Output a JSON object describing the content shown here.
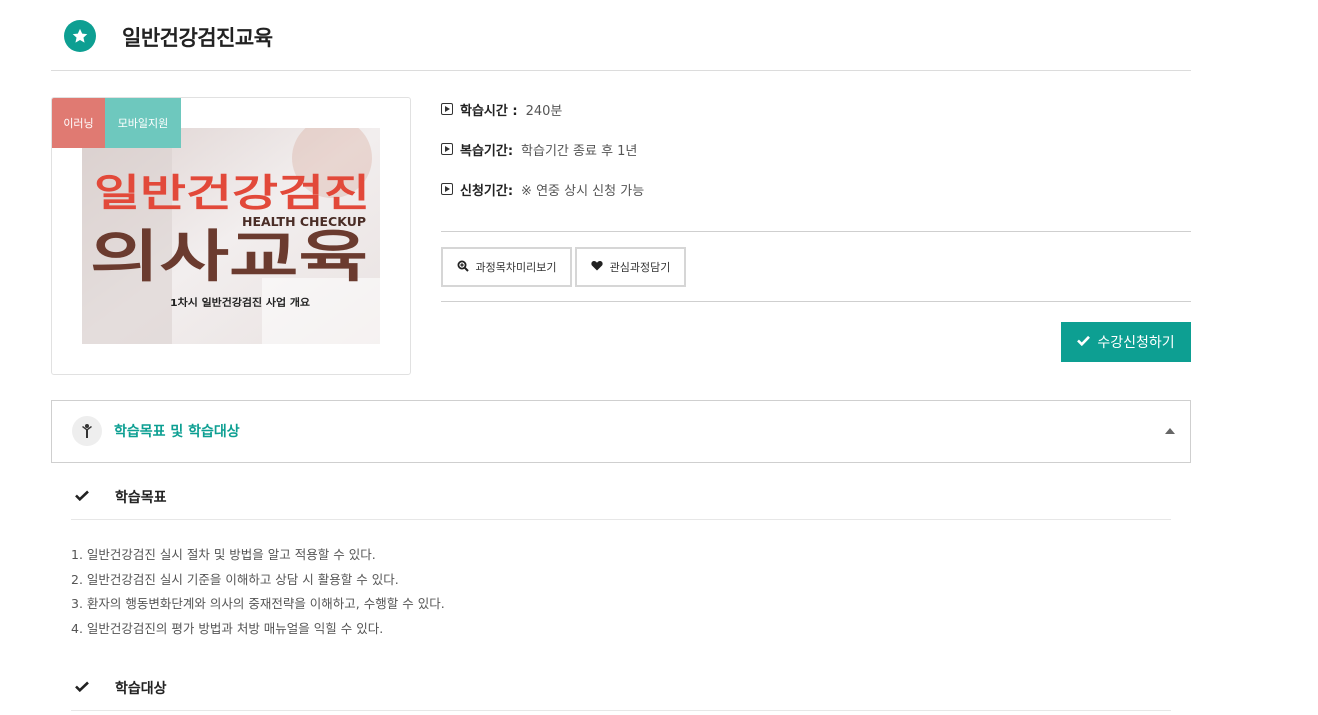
{
  "header": {
    "title": "일반건강검진교육",
    "icon": "star-icon"
  },
  "thumbnail": {
    "tags": [
      "이러닝",
      "모바일지원"
    ],
    "image_text": {
      "line1": "일반건강검진",
      "line2": "HEALTH CHECKUP",
      "line3": "의사교육",
      "caption": "1차시 일반건강검진 사업 개요"
    }
  },
  "info": {
    "study_time": {
      "label": "학습시간 :",
      "value": "240분"
    },
    "review_period": {
      "label": "복습기간:",
      "value": "학습기간 종료 후 1년"
    },
    "apply_period": {
      "label": "신청기간:",
      "value": "※ 연중 상시 신청 가능"
    }
  },
  "actions": {
    "preview_label": "과정목차미리보기",
    "wish_label": "관심과정담기",
    "apply_label": "수강신청하기"
  },
  "accordion": {
    "title": "학습목표 및 학습대상",
    "sections": [
      {
        "title": "학습목표",
        "items": [
          "1. 일반건강검진 실시 절차 및 방법을 알고 적용할 수 있다.",
          "2. 일반건강검진 실시 기준을 이해하고 상담 시 활용할 수 있다.",
          "3. 환자의 행동변화단계와 의사의 중재전략을 이해하고, 수행할 수 있다.",
          "4. 일반건강검진의 평가 방법과 처방 매뉴얼을 익힐 수 있다."
        ]
      },
      {
        "title": "학습대상"
      }
    ]
  },
  "colors": {
    "accent": "#0d9f92",
    "tag_elearning": "#e07a72",
    "tag_mobile": "#6ec8be"
  }
}
